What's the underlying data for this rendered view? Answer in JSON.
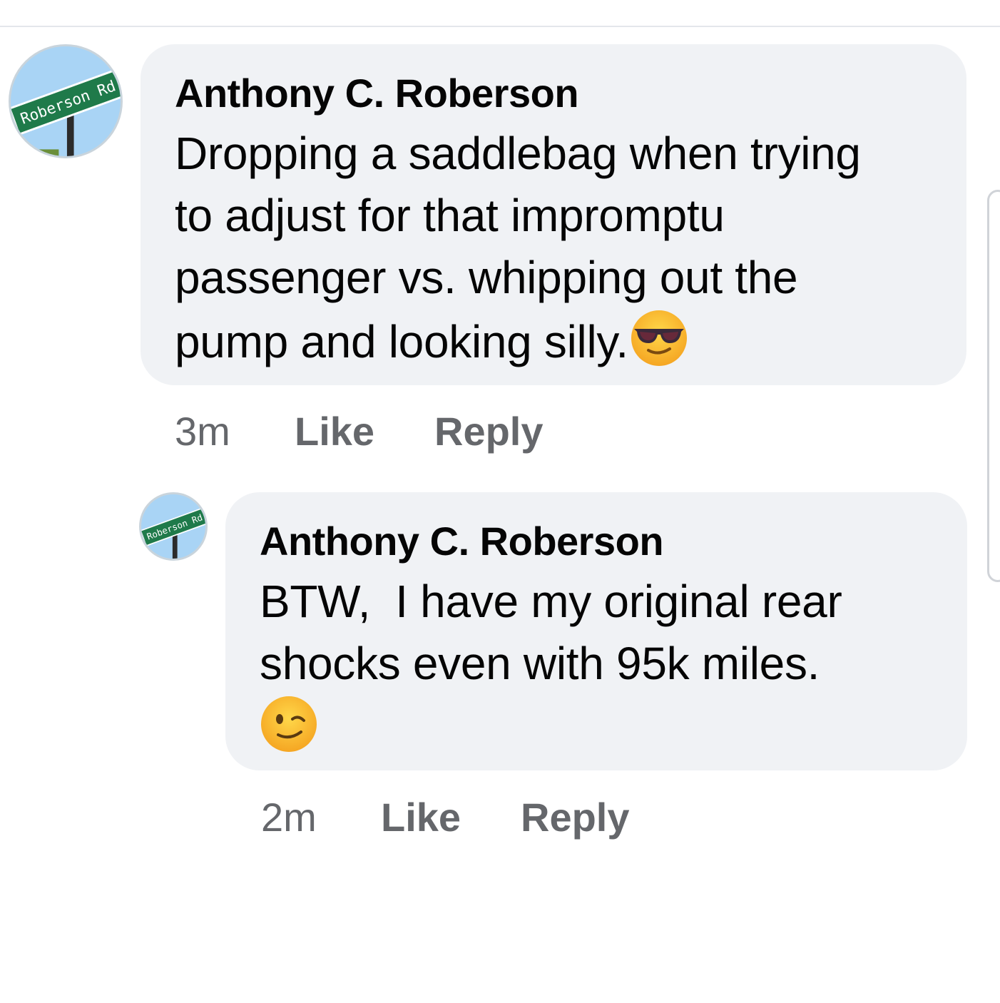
{
  "comments": [
    {
      "author": "Anthony C. Roberson",
      "avatar_sign_text": "Roberson Rd",
      "lines": [
        "Dropping a saddlebag when trying",
        "to adjust for that impromptu",
        "passenger vs. whipping out the",
        "pump and looking silly."
      ],
      "trailing_emoji": "smiling-face-with-sunglasses",
      "timestamp": "3m",
      "like_label": "Like",
      "reply_label": "Reply"
    },
    {
      "author": "Anthony C. Roberson",
      "avatar_sign_text": "Roberson Rd",
      "lines": [
        "BTW,  I have my original rear",
        "shocks even with 95k miles."
      ],
      "trailing_emoji": "winking-face",
      "timestamp": "2m",
      "like_label": "Like",
      "reply_label": "Reply"
    }
  ],
  "colors": {
    "bubble_bg": "#f0f2f5",
    "text_primary": "#050505",
    "text_secondary": "#65676b",
    "sign_green": "#1f7a4a"
  }
}
